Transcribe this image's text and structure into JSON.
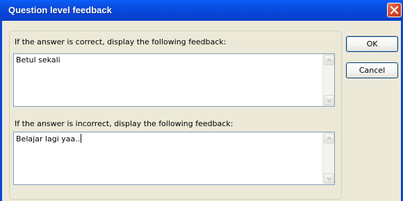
{
  "window": {
    "title": "Question level feedback"
  },
  "correct": {
    "label": "If the answer is correct, display the following feedback:",
    "value": "Betul sekali"
  },
  "incorrect": {
    "label": "If the answer is incorrect, display the following feedback:",
    "value": "Belajar lagi yaa.."
  },
  "buttons": {
    "ok": "OK",
    "cancel": "Cancel"
  },
  "icons": {
    "close": "close-icon",
    "scroll_up": "chevron-up-icon",
    "scroll_down": "chevron-down-icon"
  },
  "colors": {
    "titlebar": "#0846d8",
    "dialog_face": "#ece9d8",
    "close_button": "#d9472b"
  }
}
